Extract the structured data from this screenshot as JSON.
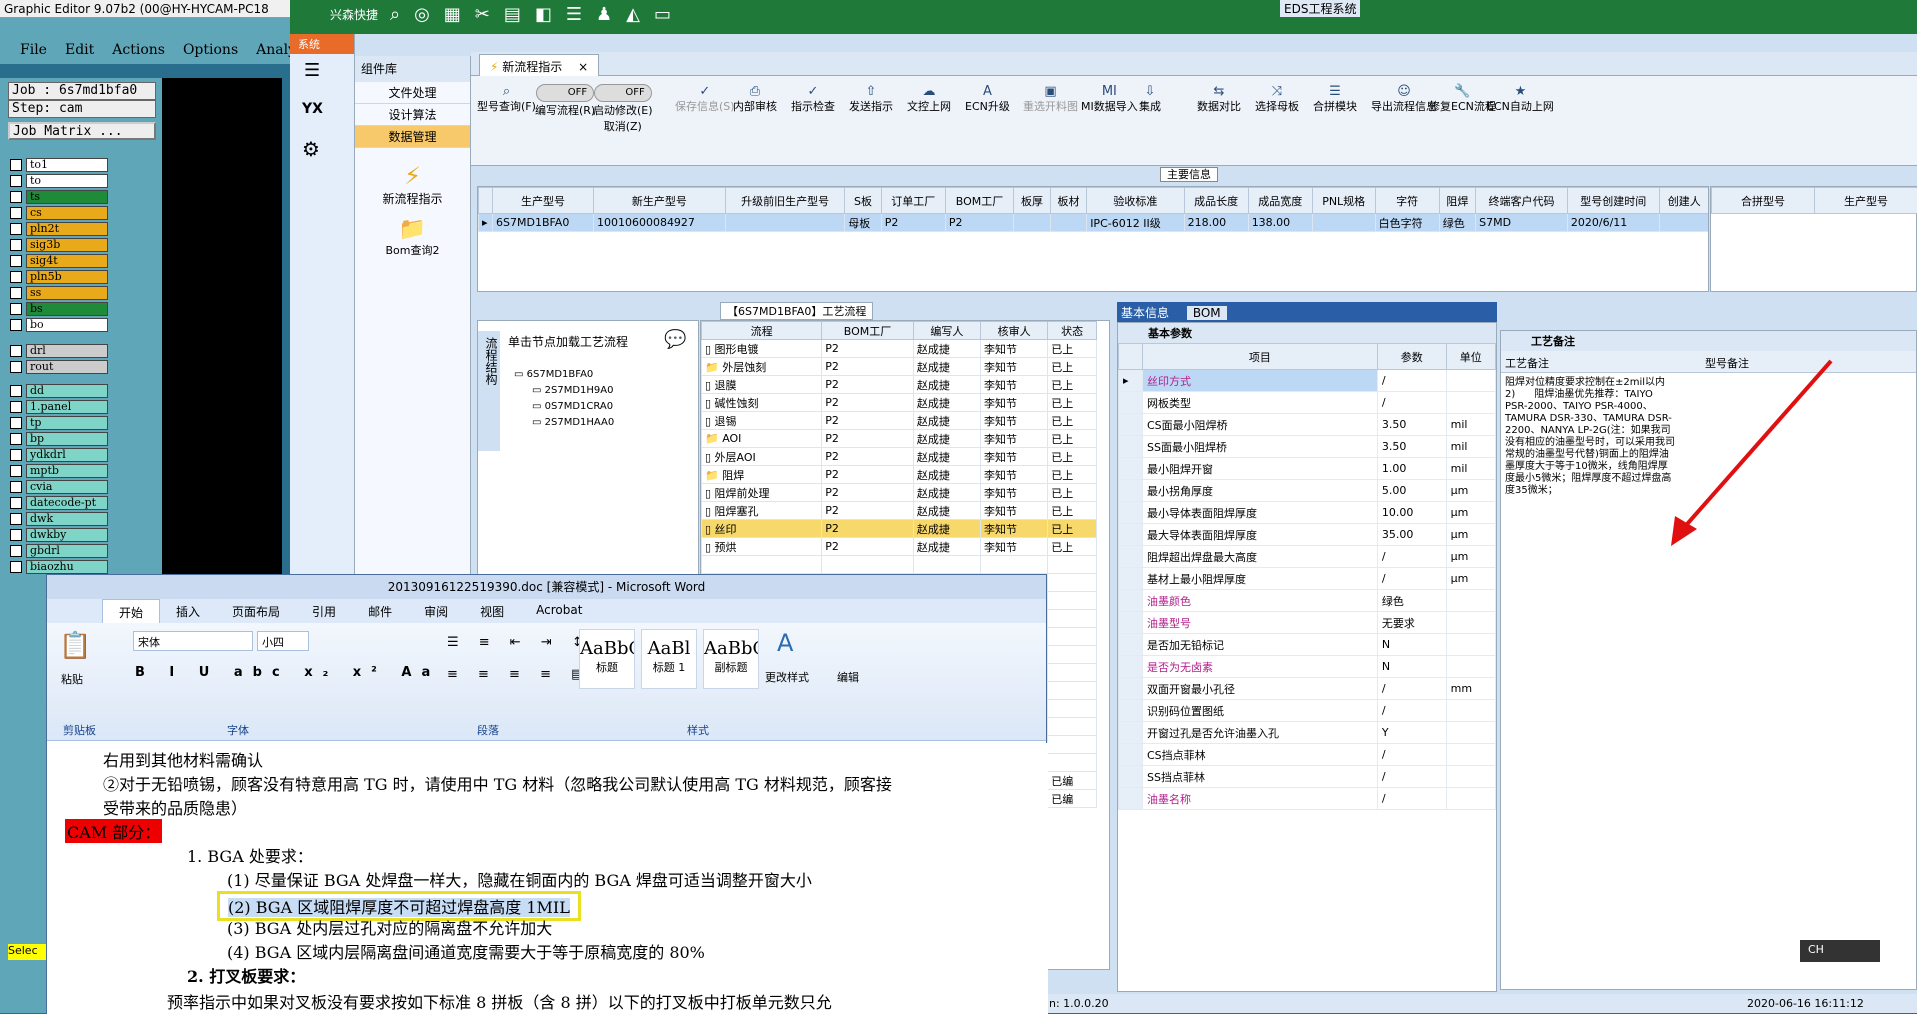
{
  "graphic_editor": {
    "title": "Graphic Editor 9.07b2 (00@HY-HYCAM-PC18",
    "menu": [
      "File",
      "Edit",
      "Actions",
      "Options",
      "Analysis"
    ],
    "job": "Job : 6s7md1bfa0",
    "step": "Step: cam",
    "job_matrix": "Job Matrix ...",
    "layers": [
      "to1",
      "to",
      "ts",
      "cs",
      "pln2t",
      "sig3b",
      "sig4t",
      "pln5b",
      "ss",
      "bs",
      "bo",
      "drl",
      "rout",
      "dd",
      "1.panel",
      "tp",
      "bp",
      "ydkdrl",
      "mptb",
      "cvia",
      "datecode-pt",
      "dwk",
      "dwkby",
      "gbdrl",
      "biaozhu"
    ],
    "select_label": "Selec"
  },
  "eds": {
    "title": "EDS工程系统",
    "quick_label": "兴森快捷",
    "system_tab": "系统",
    "left_icons": [
      "YX",
      "工具"
    ],
    "component_lib": "组件库",
    "tree_items": [
      "文件处理",
      "设计算法",
      "数据管理"
    ],
    "tree_selected": 2,
    "nav_items": [
      "新流程指示",
      "Bom查询2"
    ],
    "tab": "新流程指示",
    "toolbar": [
      {
        "icon": "search-icon",
        "label": "型号查询(F)"
      },
      {
        "icon": "toggle",
        "label": "编写流程(R)",
        "toggle": "OFF"
      },
      {
        "icon": "toggle",
        "label": "启动修改(E)\n取消(Z)",
        "toggle": "OFF"
      },
      {
        "icon": "check-icon",
        "label": "保存信息(S)"
      },
      {
        "icon": "print-icon",
        "label": "内部审核"
      },
      {
        "icon": "check-icon",
        "label": "指示检查"
      },
      {
        "icon": "upload-icon",
        "label": "发送指示"
      },
      {
        "icon": "cloud-icon",
        "label": "文控上网"
      },
      {
        "icon": "a-icon",
        "label": "ECN升级"
      },
      {
        "icon": "image-icon",
        "label": "重选开料图"
      },
      {
        "icon": "mi-icon",
        "label": "MI数据导入"
      },
      {
        "icon": "download-icon",
        "label": "集成"
      },
      {
        "icon": "compare-icon",
        "label": "数据对比"
      },
      {
        "icon": "shuffle-icon",
        "label": "选择母板"
      },
      {
        "icon": "list-icon",
        "label": "合拼模块"
      },
      {
        "icon": "smile-icon",
        "label": "导出流程信息"
      },
      {
        "icon": "wrench-icon",
        "label": "修复ECN流程"
      },
      {
        "icon": "star-icon",
        "label": "ECN自动上网"
      }
    ],
    "main_info_label": "主要信息",
    "main_grid": {
      "headers": [
        "生产型号",
        "新生产型号",
        "升级前旧生产型号",
        "S板",
        "订单工厂",
        "BOM工厂",
        "板厚",
        "板材",
        "验收标准",
        "成品长度",
        "成品宽度",
        "PNL规格",
        "字符",
        "阻焊",
        "终端客户代码",
        "型号创建时间",
        "创建人"
      ],
      "row": [
        "6S7MD1BFA0",
        "10010600084927",
        "",
        "母板",
        "P2",
        "P2",
        "",
        "",
        "IPC-6012 II级",
        "218.00",
        "138.00",
        "",
        "白色字符",
        "绿色",
        "S7MD",
        "2020/6/11",
        ""
      ]
    },
    "side_grid_headers": [
      "合拼型号",
      "生产型号"
    ],
    "flow_title": "【6S7MD1BFA0】工艺流程",
    "flow_tree_title": "单击节点加载工艺流程",
    "tree_side_label": "流程结构",
    "flow_tree_nodes": [
      "6S7MD1BFA0",
      "2S7MD1H9A0",
      "0S7MD1CRA0",
      "2S7MD1HAA0"
    ],
    "flow_headers": [
      "流程",
      "BOM工厂",
      "编写人",
      "核审人",
      "状态"
    ],
    "flow_rows": [
      [
        "图形电镀",
        "P2",
        "赵成捷",
        "李知节",
        "已上"
      ],
      [
        "外层蚀刻",
        "P2",
        "赵成捷",
        "李知节",
        "已上"
      ],
      [
        "退膜",
        "P2",
        "赵成捷",
        "李知节",
        "已上"
      ],
      [
        "碱性蚀刻",
        "P2",
        "赵成捷",
        "李知节",
        "已上"
      ],
      [
        "退锡",
        "P2",
        "赵成捷",
        "李知节",
        "已上"
      ],
      [
        "AOI",
        "P2",
        "赵成捷",
        "李知节",
        "已上"
      ],
      [
        "外层AOI",
        "P2",
        "赵成捷",
        "李知节",
        "已上"
      ],
      [
        "阻焊",
        "P2",
        "赵成捷",
        "李知节",
        "已上"
      ],
      [
        "阻焊前处理",
        "P2",
        "赵成捷",
        "李知节",
        "已上"
      ],
      [
        "阻焊塞孔",
        "P2",
        "赵成捷",
        "李知节",
        "已上"
      ],
      [
        "丝印",
        "P2",
        "赵成捷",
        "李知节",
        "已上"
      ],
      [
        "预烘",
        "P2",
        "赵成捷",
        "李知节",
        "已上"
      ]
    ],
    "flow_status_tail": [
      "已编",
      "已编"
    ],
    "basic_tabs": [
      "基本信息",
      "BOM"
    ],
    "basic_params_title": "基本参数",
    "props_headers": [
      "项目",
      "参数",
      "单位"
    ],
    "props": [
      [
        "丝印方式",
        "/",
        ""
      ],
      [
        "网板类型",
        "/",
        ""
      ],
      [
        "CS面最小阻焊桥",
        "3.50",
        "mil"
      ],
      [
        "SS面最小阻焊桥",
        "3.50",
        "mil"
      ],
      [
        "最小阻焊开窗",
        "1.00",
        "mil"
      ],
      [
        "最小拐角厚度",
        "5.00",
        "μm"
      ],
      [
        "最小导体表面阻焊厚度",
        "10.00",
        "μm"
      ],
      [
        "最大导体表面阻焊厚度",
        "35.00",
        "μm"
      ],
      [
        "阻焊超出焊盘最大高度",
        "/",
        "μm"
      ],
      [
        "基材上最小阻焊厚度",
        "/",
        "μm"
      ],
      [
        "油墨颜色",
        "绿色",
        ""
      ],
      [
        "油墨型号",
        "无要求",
        ""
      ],
      [
        "是否加无铅标记",
        "N",
        ""
      ],
      [
        "是否为无卤素",
        "N",
        ""
      ],
      [
        "双面开窗最小孔径",
        "/",
        "mm"
      ],
      [
        "识别码位置图纸",
        "/",
        ""
      ],
      [
        "开窗过孔是否允许油墨入孔",
        "Y",
        ""
      ],
      [
        "CS挡点菲林",
        "/",
        ""
      ],
      [
        "SS挡点菲林",
        "/",
        ""
      ],
      [
        "油墨名称",
        "/",
        ""
      ]
    ],
    "process_notes_title": "工艺备注",
    "notes_cols": [
      "工艺备注",
      "型号备注"
    ],
    "notes_text": "阻焊对位精度要求控制在±2mil以内\n2)      阻焊油墨优先推荐：TAIYO PSR-2000、TAIYO PSR-4000、TAMURA DSR-330、TAMURA DSR-2200、NANYA LP-2G(注：如果我司没有相应的油墨型号时，可以采用我司常规的油墨型号代替)铜面上的阻焊油墨厚度大于等于10微米，线角阻焊厚度最小5微米；阻焊厚度不超过焊盘高度35微米；",
    "status": {
      "version": "n: 1.0.0.20",
      "datetime": "2020-06-16 16:11:12",
      "ime": "CH"
    }
  },
  "word": {
    "title": "20130916122519390.doc [兼容模式] - Microsoft Word",
    "tabs": [
      "开始",
      "插入",
      "页面布局",
      "引用",
      "邮件",
      "审阅",
      "视图",
      "Acrobat"
    ],
    "active_tab": 0,
    "font": "宋体",
    "size": "小四",
    "groups": [
      "剪贴板",
      "字体",
      "段落",
      "样式"
    ],
    "paste": "粘贴",
    "styles": [
      {
        "sample": "AaBbC",
        "name": "标题"
      },
      {
        "sample": "AaBl",
        "name": "标题 1"
      },
      {
        "sample": "AaBbC",
        "name": "副标题"
      }
    ],
    "change_styles": "更改样式",
    "edit": "编辑",
    "doc_lines": [
      "右用到其他材料需确认",
      "②对于无铅喷锡，顾客没有特意用高 TG 时，请使用中 TG 材料（忽略我公司默认使用高 TG 材料规范，顾客接",
      "受带来的品质隐患）"
    ],
    "cam_label": "CAM 部分：",
    "bga_title": "1. BGA 处要求：",
    "bga_items": [
      "(1) 尽量保证 BGA 处焊盘一样大，隐藏在铜面内的 BGA 焊盘可适当调整开窗大小",
      "(2) BGA 区域阻焊厚度不可超过焊盘高度 1MIL",
      "(3) BGA 处内层过孔对应的隔离盘不允许加大",
      "(4) BGA 区域内层隔离盘间通道宽度需要大于等于原稿宽度的 80%"
    ],
    "section2": "2. 打叉板要求：",
    "last_line": "预率指示中如果对叉板没有要求按如下标准 8 拼板（含 8 拼）以下的打叉板中打板单元数只允"
  }
}
